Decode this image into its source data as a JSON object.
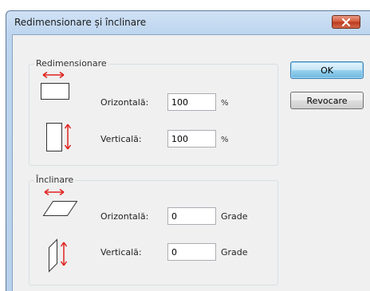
{
  "window": {
    "title": "Redimensionare și înclinare"
  },
  "resize": {
    "group_title": "Redimensionare",
    "horizontal_label": "Orizontală:",
    "horizontal_value": "100",
    "horizontal_unit": "%",
    "vertical_label": "Verticală:",
    "vertical_value": "100",
    "vertical_unit": "%"
  },
  "skew": {
    "group_title": "Înclinare",
    "horizontal_label": "Orizontală:",
    "horizontal_value": "0",
    "horizontal_unit": "Grade",
    "vertical_label": "Verticală:",
    "vertical_value": "0",
    "vertical_unit": "Grade"
  },
  "buttons": {
    "ok_label": "OK",
    "cancel_label": "Revocare"
  },
  "icons": {
    "close": "close-icon",
    "resize_horizontal": "resize-horizontal-icon",
    "resize_vertical": "resize-vertical-icon",
    "skew_horizontal": "skew-horizontal-icon",
    "skew_vertical": "skew-vertical-icon"
  },
  "colors": {
    "arrow": "#e0201c",
    "close_button": "#c94a2c",
    "default_button": "#6db8de"
  }
}
